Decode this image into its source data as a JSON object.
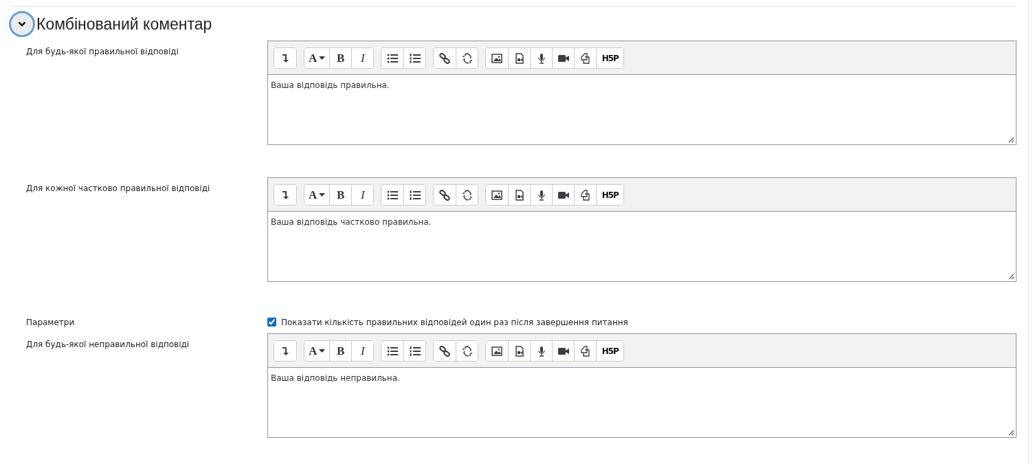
{
  "section": {
    "title": "Комбінований коментар",
    "expanded": true
  },
  "rows": [
    {
      "kind": "editor",
      "label": "Для будь-якої правильної відповіді",
      "content": "Ваша відповідь правильна.",
      "toolbar": [
        {
          "buttons": [
            {
              "kind": "indent"
            }
          ]
        },
        {
          "buttons": [
            {
              "kind": "style",
              "text": "A"
            },
            {
              "kind": "bold",
              "text": "B"
            },
            {
              "kind": "italic",
              "text": "I"
            }
          ]
        },
        {
          "buttons": [
            {
              "kind": "ul"
            },
            {
              "kind": "ol"
            }
          ]
        },
        {
          "buttons": [
            {
              "kind": "link"
            },
            {
              "kind": "unlink"
            }
          ]
        },
        {
          "buttons": [
            {
              "kind": "image"
            },
            {
              "kind": "media"
            },
            {
              "kind": "mic"
            },
            {
              "kind": "video"
            },
            {
              "kind": "files"
            },
            {
              "kind": "h5p",
              "text": "H5P"
            }
          ]
        }
      ]
    },
    {
      "kind": "editor",
      "label": "Для кожної частково правильної відповіді",
      "content": "Ваша відповідь частково правильна.",
      "toolbar": [
        {
          "buttons": [
            {
              "kind": "indent"
            }
          ]
        },
        {
          "buttons": [
            {
              "kind": "style",
              "text": "A"
            },
            {
              "kind": "bold",
              "text": "B"
            },
            {
              "kind": "italic",
              "text": "I"
            }
          ]
        },
        {
          "buttons": [
            {
              "kind": "ul"
            },
            {
              "kind": "ol"
            }
          ]
        },
        {
          "buttons": [
            {
              "kind": "link"
            },
            {
              "kind": "unlink"
            }
          ]
        },
        {
          "buttons": [
            {
              "kind": "image"
            },
            {
              "kind": "media"
            },
            {
              "kind": "mic"
            },
            {
              "kind": "video"
            },
            {
              "kind": "files"
            },
            {
              "kind": "h5p",
              "text": "H5P"
            }
          ]
        }
      ]
    },
    {
      "kind": "checkbox",
      "label": "Параметри",
      "option": "Показати кількість правильних відповідей один раз після завершення питання",
      "checked": true
    },
    {
      "kind": "editor",
      "label": "Для будь-якої неправильної відповіді",
      "content": "Ваша відповідь неправильна.",
      "toolbar": [
        {
          "buttons": [
            {
              "kind": "indent"
            }
          ]
        },
        {
          "buttons": [
            {
              "kind": "style",
              "text": "A"
            },
            {
              "kind": "bold",
              "text": "B"
            },
            {
              "kind": "italic",
              "text": "I"
            }
          ]
        },
        {
          "buttons": [
            {
              "kind": "ul"
            },
            {
              "kind": "ol"
            }
          ]
        },
        {
          "buttons": [
            {
              "kind": "link"
            },
            {
              "kind": "unlink"
            }
          ]
        },
        {
          "buttons": [
            {
              "kind": "image"
            },
            {
              "kind": "media"
            },
            {
              "kind": "mic"
            },
            {
              "kind": "video"
            },
            {
              "kind": "files"
            },
            {
              "kind": "h5p",
              "text": "H5P"
            }
          ]
        }
      ]
    }
  ]
}
